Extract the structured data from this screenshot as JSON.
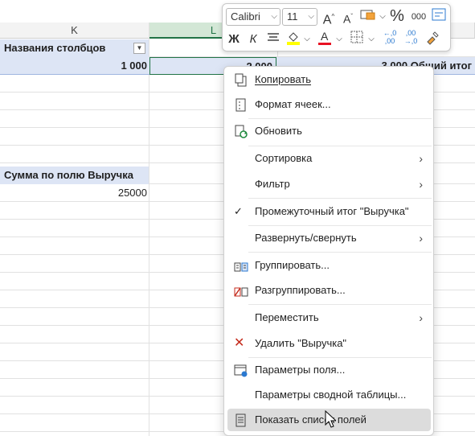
{
  "columns": {
    "k": "K",
    "l": "L"
  },
  "pivot": {
    "col_labels_header": "Названия столбцов",
    "k_value": "1 000",
    "l_value_partial": "2 000",
    "grand_total_partial": "3 000 Общий итог",
    "sum_field_header": "Сумма по полю Выручка",
    "sum_value": "25000"
  },
  "mini_toolbar": {
    "font_name": "Calibri",
    "font_size": "11",
    "bold_label": "Ж",
    "italic_label": "К",
    "percent_label": "%",
    "thousands_label": "000",
    "increase_dec": "←,0\n,00",
    "decrease_dec": ",00\n→,0"
  },
  "menu": {
    "items": [
      {
        "label": "Копировать",
        "icon": "copy-icon"
      },
      {
        "label": "Формат ячеек...",
        "icon": "format-cells-icon"
      },
      {
        "label": "Обновить",
        "icon": "refresh-icon"
      },
      {
        "label": "Сортировка",
        "submenu": true
      },
      {
        "label": "Фильтр",
        "submenu": true
      },
      {
        "label": "Промежуточный итог \"Выручка\"",
        "icon": "checkmark-icon"
      },
      {
        "label": "Развернуть/свернуть",
        "submenu": true
      },
      {
        "label": "Группировать...",
        "icon": "group-icon"
      },
      {
        "label": "Разгруппировать...",
        "icon": "ungroup-icon"
      },
      {
        "label": "Переместить",
        "submenu": true
      },
      {
        "label": "Удалить \"Выручка\"",
        "icon": "delete-icon"
      },
      {
        "label": "Параметры поля...",
        "icon": "field-settings-icon"
      },
      {
        "label": "Параметры сводной таблицы..."
      },
      {
        "label": "Показать список полей",
        "icon": "field-list-icon"
      }
    ]
  },
  "colors": {
    "accent_green": "#217346",
    "pivot_header_bg": "#dde5f5",
    "font_color_red": "#e81123",
    "highlight_yellow": "#ffff00",
    "menu_hover": "#dcdcdc"
  }
}
